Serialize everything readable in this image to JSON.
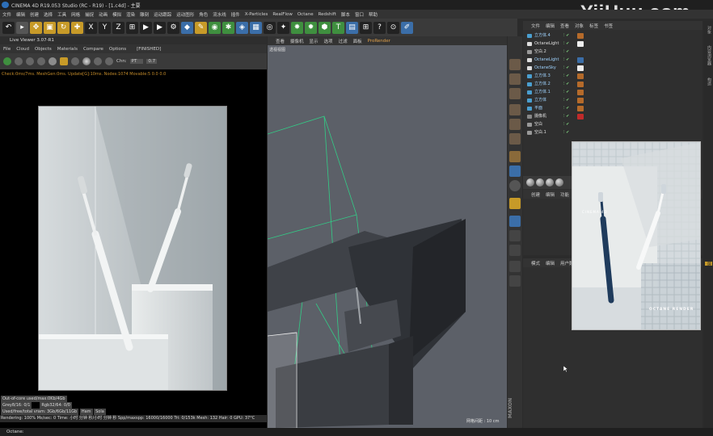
{
  "window": {
    "title": "CINEMA 4D R19.053 Studio (RC - R19) - [1.c4d] - 主要",
    "watermark": "YiiHuu.com",
    "controls": [
      "—",
      "▢",
      "✕"
    ]
  },
  "menubar": [
    "文件",
    "编辑",
    "创建",
    "选择",
    "工具",
    "网格",
    "捕捉",
    "动画",
    "模拟",
    "渲染",
    "雕刻",
    "运动跟踪",
    "运动图形",
    "角色",
    "流水线",
    "插件",
    "X-Particles",
    "RealFlow",
    "Octane",
    "Redshift",
    "脚本",
    "窗口",
    "帮助"
  ],
  "toolbar": {
    "axis_x": "X",
    "axis_y": "Y",
    "axis_z": "Z"
  },
  "live_viewer": {
    "title": "Live Viewer 3.07-R1",
    "menu": [
      "File",
      "Cloud",
      "Objects",
      "Materials",
      "Compare",
      "Options"
    ],
    "finished_label": "[FINISHED]",
    "channel_label": "Chn:",
    "channel_value": "PT",
    "channel_num": "0.7",
    "status_line": "Check:0ms/7ms. MeshGen:0ms. Update[G]:10ms. Nodes:1074 Movable:5 0.0 0.0",
    "stats": {
      "row1": "Out-of-core used/max:0Kb/4Gb",
      "row2_a": "Grey8/16: 0/1",
      "row2_b": "Rgb32/64: 0/0",
      "row3": "Used/free/total vram: 3Gb/6Gb/11Gb",
      "row3_btn1": "Ham",
      "row3_btn2": "Sola"
    },
    "render_bar": "Rendering: 100%   Ms/sec: 0   Time: 小时 分钟 秒/小时 分钟 秒   Spp/maxspp: 16000/16000   Tri: 0/153k   Mesh: 132   Hair: 0   GPU:   37°C"
  },
  "viewport": {
    "menu": [
      "查看",
      "摄像机",
      "显示",
      "选项",
      "过滤",
      "面板",
      "ProRender"
    ],
    "label": "透视视图",
    "grid_label": "网格间距 : 10 cm"
  },
  "object_manager": {
    "menu": [
      "文件",
      "编辑",
      "查看",
      "对象",
      "标签",
      "书签"
    ],
    "rows": [
      {
        "name": "立方体.4",
        "icon": "cube-icon"
      },
      {
        "name": "OctaneLight",
        "icon": "light-icon"
      },
      {
        "name": "空白.2",
        "icon": "null-icon"
      },
      {
        "name": "OctaneLight",
        "icon": "light-icon"
      },
      {
        "name": "OctaneSky",
        "icon": "sky-icon"
      },
      {
        "name": "立方体.3",
        "icon": "cube-icon"
      },
      {
        "name": "立方体.2",
        "icon": "cube-icon"
      },
      {
        "name": "立方体.1",
        "icon": "cube-icon"
      },
      {
        "name": "立方体",
        "icon": "cube-icon"
      },
      {
        "name": "平面",
        "icon": "plane-icon"
      },
      {
        "name": "摄像机",
        "icon": "camera-icon"
      },
      {
        "name": "空白",
        "icon": "null-icon"
      },
      {
        "name": "空白.1",
        "icon": "null-icon"
      }
    ]
  },
  "attributes": {
    "menu": [
      "创建",
      "编辑",
      "功能"
    ]
  },
  "layers": {
    "menu": [
      "模式",
      "编辑",
      "用户数据"
    ]
  },
  "side_tabs": [
    "对象",
    "内容浏览器",
    "构造",
    "层"
  ],
  "poster": {
    "line1": "CINEMA 4D",
    "line2": "OCTANE RENDER"
  },
  "status_bar": "Octane:",
  "colors": {
    "accent_orange": "#c79a28",
    "om_text": "#9fd3ff",
    "toothbrush_blue": "#1f3b5c"
  }
}
